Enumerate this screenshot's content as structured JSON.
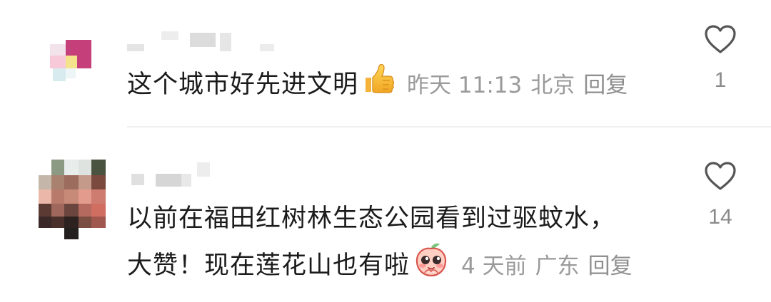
{
  "comments": [
    {
      "text": "这个城市好先进文明",
      "emoji": "thumbs-up-emoji",
      "time": "昨天 11:13",
      "location": "北京",
      "reply_label": "回复",
      "likes": "1"
    },
    {
      "text_line1": "以前在福田红树林生态公园看到过驱蚊水，",
      "text_line2": "大赞！现在莲花山也有啦",
      "emoji": "peach-face-emoji",
      "time": "4 天前",
      "location": "广东",
      "reply_label": "回复",
      "likes": "14"
    }
  ],
  "colors": {
    "text": "#1b1b1b",
    "meta": "#9a9a9a",
    "divider": "#efefef",
    "heart_outline": "#555555"
  }
}
